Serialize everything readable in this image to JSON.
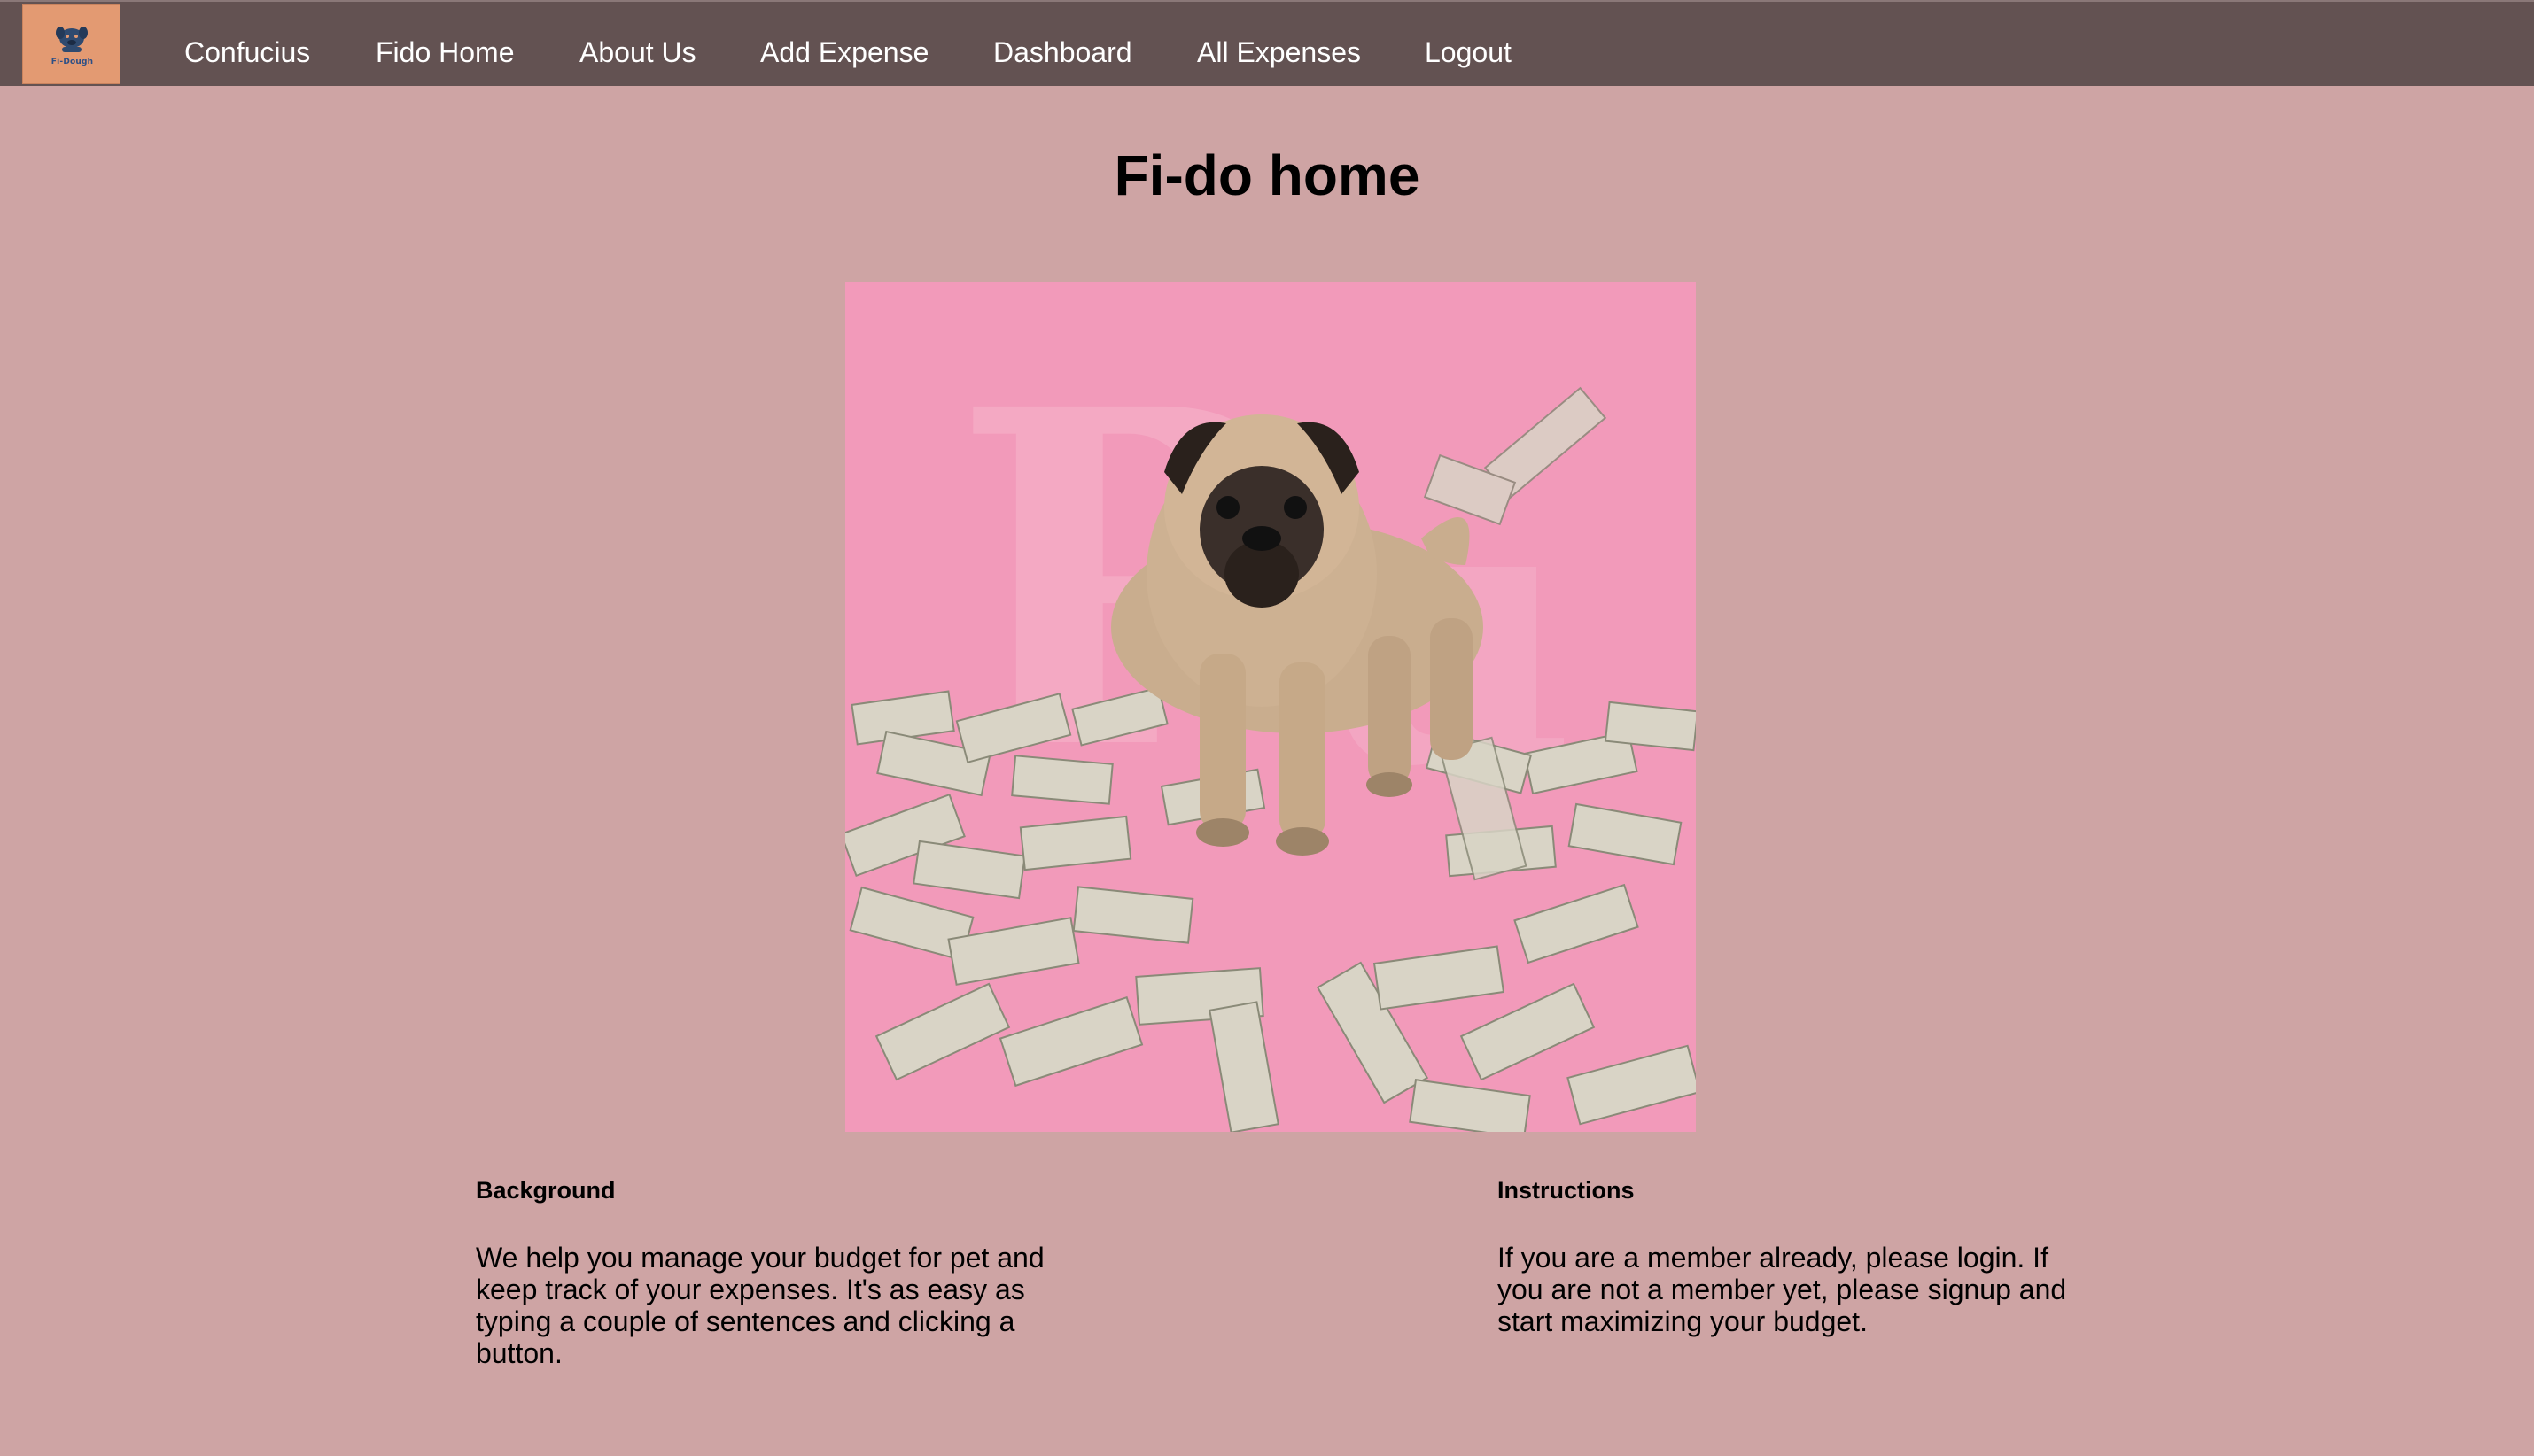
{
  "logo": {
    "text": "Fi-Dough"
  },
  "nav": {
    "items": [
      "Confucius",
      "Fido Home",
      "About Us",
      "Add Expense",
      "Dashboard",
      "All Expenses",
      "Logout"
    ]
  },
  "main": {
    "title": "Fi-do home",
    "hero_image": {
      "icon": "pug-with-money-image"
    }
  },
  "background": {
    "heading": "Background",
    "text": "We help you manage your budget for pet and keep track of your expenses. It's as easy as typing a couple of sentences and clicking a button."
  },
  "instructions": {
    "heading": "Instructions",
    "text": "If you are a member already, please login. If you are not a member yet, please signup and start maximizing your budget."
  },
  "colors": {
    "page_bg": "#cea4a4",
    "nav_bg": "#635252",
    "logo_bg": "#e39a72",
    "image_bg": "#f29aba",
    "nav_text": "#ffffff"
  }
}
